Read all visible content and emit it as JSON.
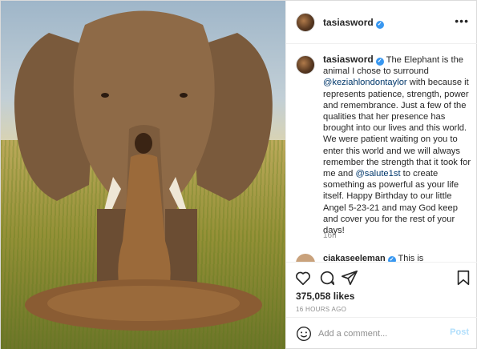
{
  "post": {
    "username": "tasiasword",
    "verified_glyph": "✓",
    "more_glyph": "•••",
    "image_alt": "Woman in leopard print gown standing in front of an elephant in a grassland"
  },
  "caption": {
    "username": "tasiasword",
    "text_1": "The Elephant is the animal I chose to surround ",
    "mention_1": "@keziahlondontaylor",
    "text_2": " with because it represents patience, strength, power and remembrance. Just a few of the qualities that her presence has brought into our lives and this world. We were patient waiting on you to enter this world and we will always remember the strength that it took for me and ",
    "mention_2": "@salute1st",
    "text_3": " to create something as powerful as your life itself. Happy Birthday to our little Angel 5-23-21 and may God keep and cover you for the rest of your days!",
    "age": "16h"
  },
  "next_comment": {
    "username": "ciakaseeleman",
    "text": "This is"
  },
  "actions": {
    "icons": [
      "heart-icon",
      "comment-icon",
      "share-icon",
      "bookmark-icon"
    ]
  },
  "likes": "375,058 likes",
  "posted": "16 HOURS AGO",
  "composer": {
    "placeholder": "Add a comment...",
    "post_label": "Post"
  }
}
